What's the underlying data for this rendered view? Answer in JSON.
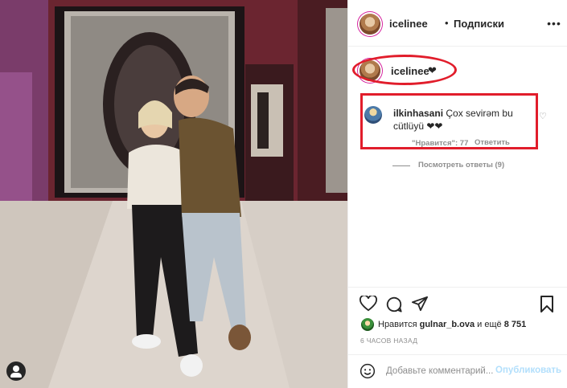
{
  "header": {
    "username": "icelinee",
    "separator": "•",
    "follow_label": "Подписки",
    "more_label": "•••"
  },
  "caption": {
    "username": "icelinee",
    "text": "❤"
  },
  "comment": {
    "username": "ilkinhasani",
    "text_line1": "Çox sevirəm bu",
    "text_line2": "cütlüyü ❤❤",
    "likes_label": "\"Нравится\": 77",
    "reply_label": "Ответить",
    "like_icon": "♡"
  },
  "replies": {
    "label": "Посмотреть ответы (9)"
  },
  "likes": {
    "prefix": "Нравится",
    "user": "gulnar_b.ova",
    "middle": "и ещё",
    "count": "8 751"
  },
  "timestamp": "6 ЧАСОВ НАЗАД",
  "comment_box": {
    "placeholder": "Добавьте комментарий...",
    "post_label": "Опубликовать"
  },
  "icons": {
    "like": "heart-icon",
    "comment": "comment-icon",
    "share": "share-icon",
    "save": "bookmark-icon",
    "emoji": "smiley-icon",
    "photo_tags": "user-icon"
  },
  "colors": {
    "annotation": "#e11d2b",
    "link_disabled": "#b2dffc",
    "muted_text": "#8e8e8e"
  }
}
